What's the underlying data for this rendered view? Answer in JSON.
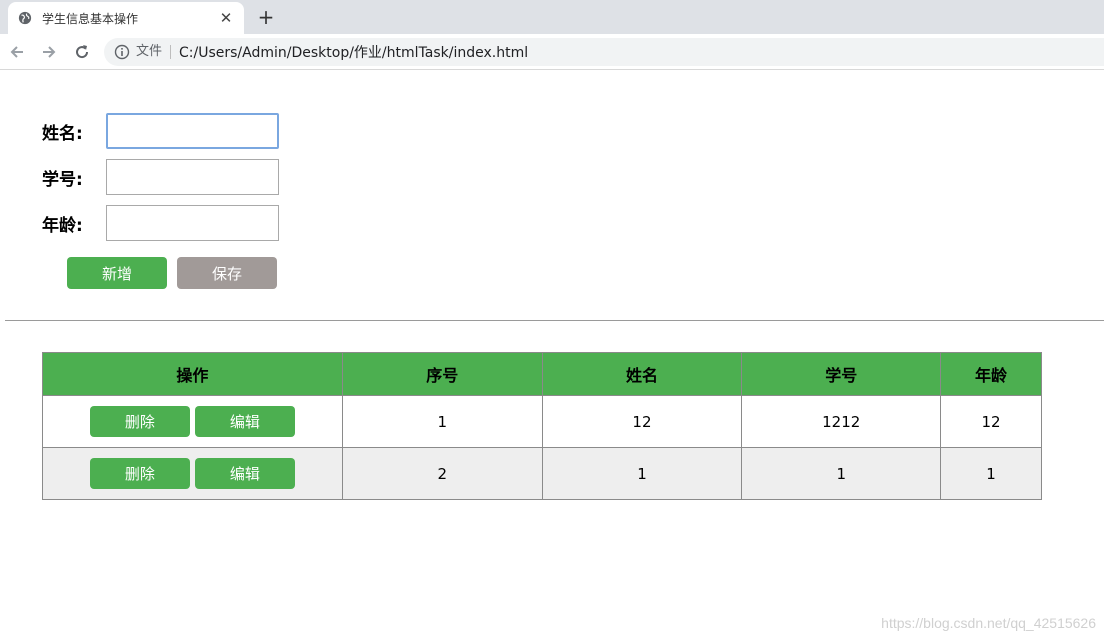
{
  "browser": {
    "tab_title": "学生信息基本操作",
    "new_tab_symbol": "+",
    "close_symbol": "✕",
    "address_scheme": "文件",
    "address_url": "C:/Users/Admin/Desktop/作业/htmlTask/index.html"
  },
  "form": {
    "name_label": "姓名:",
    "id_label": "学号:",
    "age_label": "年龄:",
    "name_value": "",
    "id_value": "",
    "age_value": "",
    "add_button": "新增",
    "save_button": "保存"
  },
  "table": {
    "headers": [
      "操作",
      "序号",
      "姓名",
      "学号",
      "年龄"
    ],
    "delete_label": "删除",
    "edit_label": "编辑",
    "rows": [
      {
        "index": "1",
        "name": "12",
        "student_id": "1212",
        "age": "12"
      },
      {
        "index": "2",
        "name": "1",
        "student_id": "1",
        "age": "1"
      }
    ]
  },
  "watermark": "https://blog.csdn.net/qq_42515626",
  "colors": {
    "accent_green": "#4caf50",
    "save_grey": "#a19a98",
    "alt_row": "#eeeeee"
  }
}
